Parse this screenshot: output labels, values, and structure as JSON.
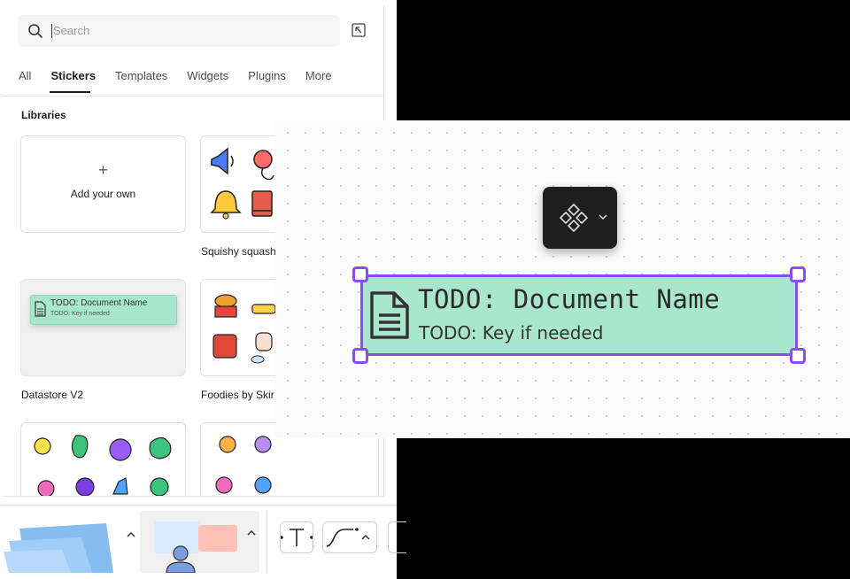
{
  "search": {
    "placeholder": "Search"
  },
  "tabs": [
    "All",
    "Stickers",
    "Templates",
    "Widgets",
    "Plugins",
    "More"
  ],
  "active_tab": "Stickers",
  "libraries": {
    "title": "Libraries",
    "add_own": {
      "plus": "+",
      "label": "Add your own"
    },
    "items": [
      {
        "name": "Squishy squash"
      },
      {
        "name": "Datastore V2"
      },
      {
        "name": "Foodies by Skir"
      }
    ],
    "datastore_preview": {
      "title": "TODO: Document Name",
      "subtitle": "TODO: Key if needed"
    }
  },
  "canvas": {
    "document": {
      "title": "TODO: Document Name",
      "subtitle": "TODO: Key if needed",
      "color": "#a8e6cf"
    },
    "selection_color": "#8a4df2",
    "component_menu": {
      "icon": "component-icon",
      "chevron": "chevron-down-icon"
    }
  },
  "colors": {
    "accent": "#8a4df2",
    "doc_fill": "#a8e6cf",
    "sticky": "#9fcdf7"
  }
}
